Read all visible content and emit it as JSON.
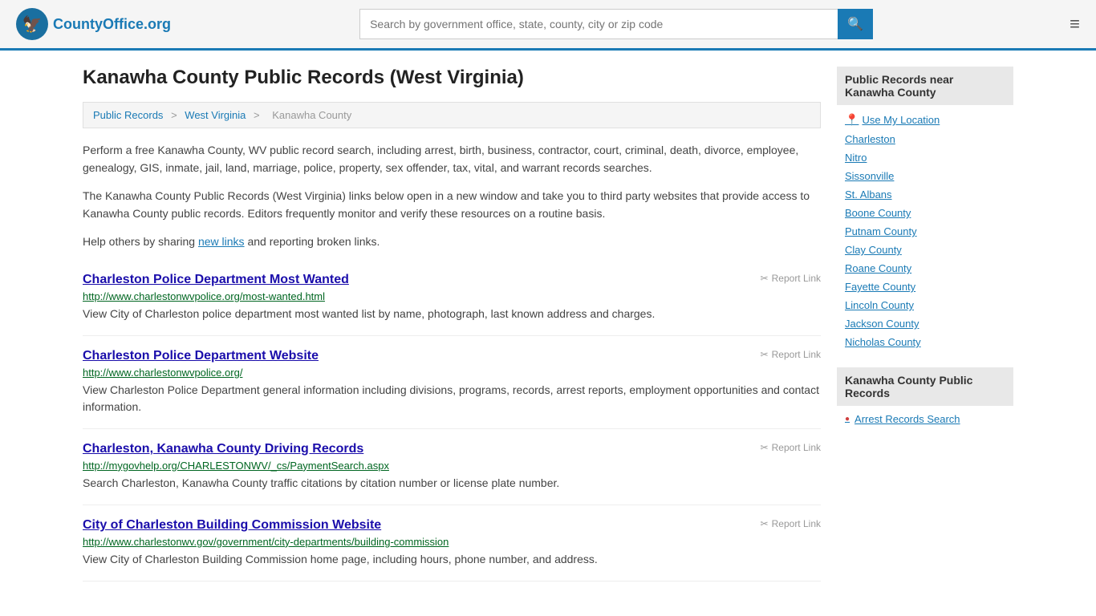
{
  "header": {
    "logo_text": "CountyOffice",
    "logo_suffix": ".org",
    "search_placeholder": "Search by government office, state, county, city or zip code",
    "search_value": ""
  },
  "page": {
    "title": "Kanawha County Public Records (West Virginia)",
    "breadcrumb": {
      "items": [
        "Public Records",
        "West Virginia",
        "Kanawha County"
      ]
    },
    "description1": "Perform a free Kanawha County, WV public record search, including arrest, birth, business, contractor, court, criminal, death, divorce, employee, genealogy, GIS, inmate, jail, land, marriage, police, property, sex offender, tax, vital, and warrant records searches.",
    "description2": "The Kanawha County Public Records (West Virginia) links below open in a new window and take you to third party websites that provide access to Kanawha County public records. Editors frequently monitor and verify these resources on a routine basis.",
    "description3_pre": "Help others by sharing ",
    "description3_link": "new links",
    "description3_post": " and reporting broken links.",
    "results": [
      {
        "title": "Charleston Police Department Most Wanted",
        "url": "http://www.charlestonwvpolice.org/most-wanted.html",
        "description": "View City of Charleston police department most wanted list by name, photograph, last known address and charges.",
        "report_label": "Report Link"
      },
      {
        "title": "Charleston Police Department Website",
        "url": "http://www.charlestonwvpolice.org/",
        "description": "View Charleston Police Department general information including divisions, programs, records, arrest reports, employment opportunities and contact information.",
        "report_label": "Report Link"
      },
      {
        "title": "Charleston, Kanawha County Driving Records",
        "url": "http://mygovhelp.org/CHARLESTONWV/_cs/PaymentSearch.aspx",
        "description": "Search Charleston, Kanawha County traffic citations by citation number or license plate number.",
        "report_label": "Report Link"
      },
      {
        "title": "City of Charleston Building Commission Website",
        "url": "http://www.charlestonwv.gov/government/city-departments/building-commission",
        "description": "View City of Charleston Building Commission home page, including hours, phone number, and address.",
        "report_label": "Report Link"
      }
    ]
  },
  "sidebar": {
    "nearby_heading": "Public Records near Kanawha County",
    "use_my_location": "Use My Location",
    "nearby_links": [
      "Charleston",
      "Nitro",
      "Sissonville",
      "St. Albans",
      "Boone County",
      "Putnam County",
      "Clay County",
      "Roane County",
      "Fayette County",
      "Lincoln County",
      "Jackson County",
      "Nicholas County"
    ],
    "records_heading": "Kanawha County Public Records",
    "records_links": [
      "Arrest Records Search"
    ]
  }
}
